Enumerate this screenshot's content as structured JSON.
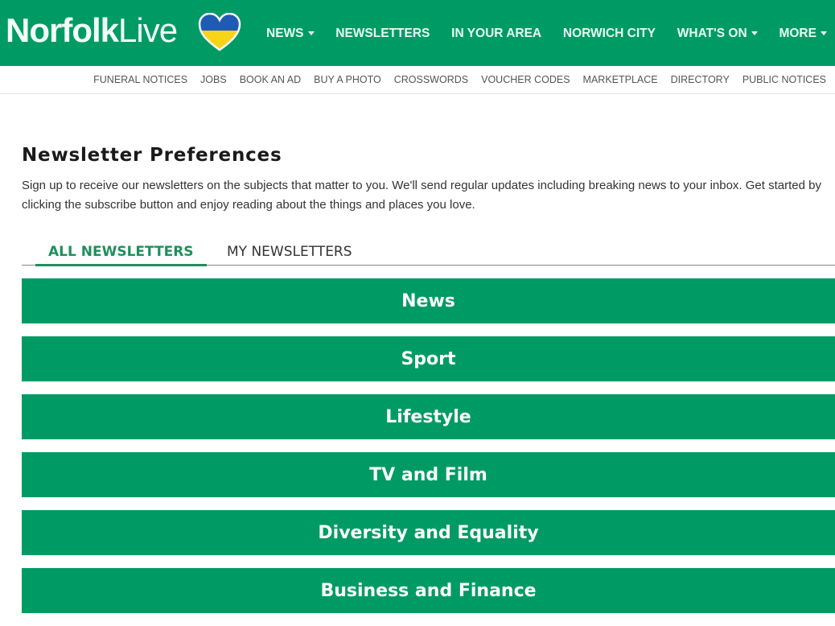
{
  "colors": {
    "brand": "#009b65",
    "tab_active": "#1f8f5c",
    "heart_top": "#1f5bb5",
    "heart_bottom": "#f7d417"
  },
  "header": {
    "logo": {
      "bold": "Norfolk",
      "light": "Live",
      "icon": "ukraine-heart-icon"
    },
    "nav": [
      {
        "label": "NEWS",
        "dropdown": true
      },
      {
        "label": "NEWSLETTERS",
        "dropdown": false
      },
      {
        "label": "IN YOUR AREA",
        "dropdown": false
      },
      {
        "label": "NORWICH CITY",
        "dropdown": false
      },
      {
        "label": "WHAT'S ON",
        "dropdown": true
      },
      {
        "label": "MORE",
        "dropdown": true
      }
    ],
    "subnav": [
      "FUNERAL NOTICES",
      "JOBS",
      "BOOK AN AD",
      "BUY A PHOTO",
      "CROSSWORDS",
      "VOUCHER CODES",
      "MARKETPLACE",
      "DIRECTORY",
      "PUBLIC NOTICES"
    ]
  },
  "main": {
    "title": "Newsletter Preferences",
    "intro": "Sign up to receive our newsletters on the subjects that matter to you. We'll send regular updates including breaking news to your inbox. Get started by clicking the subscribe button and enjoy reading about the things and places you love.",
    "tabs": [
      {
        "label": "ALL NEWSLETTERS",
        "active": true
      },
      {
        "label": "MY NEWSLETTERS",
        "active": false
      }
    ],
    "categories": [
      "News",
      "Sport",
      "Lifestyle",
      "TV and Film",
      "Diversity and Equality",
      "Business and Finance"
    ]
  }
}
